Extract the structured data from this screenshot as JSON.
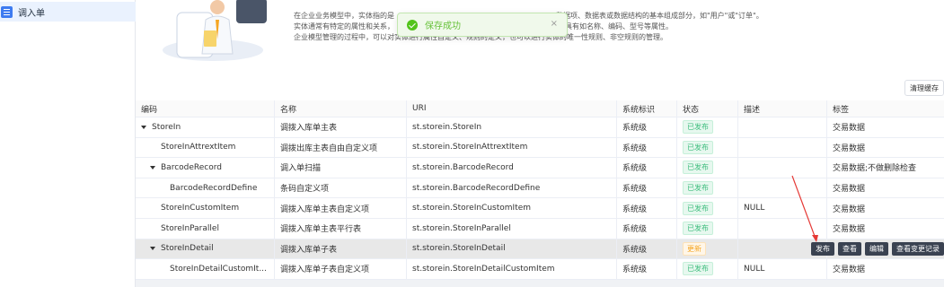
{
  "sidebar": {
    "item_label": "调入单"
  },
  "banner": {
    "line1_left": "在企业业务模型中，实体指的是",
    "line1_right": "数据项、数据表或数据结构的基本组成部分，如\"用户\"或\"订单\"。",
    "line2_left": "实体通常有特定的属性和关系，",
    "line2_right": "一个实体，具有如名称、编码、型号等属性。",
    "line3": "企业模型管理的过程中，可以对实体进行属性自定义、规则的定义，也可以进行实体的唯一性规则、非空规则的管理。"
  },
  "toast": {
    "message": "保存成功",
    "close": "×"
  },
  "toolbar": {
    "clear_cache": "清理缓存"
  },
  "table": {
    "headers": [
      "编码",
      "名称",
      "URI",
      "系统标识",
      "状态",
      "描述",
      "标签"
    ],
    "rows": [
      {
        "code": "StoreIn",
        "name": "调拨入库单主表",
        "uri": "st.storein.StoreIn",
        "sys": "系统级",
        "status": "已发布",
        "desc": "",
        "tag": "交易数据"
      },
      {
        "code": "StoreInAttrextItem",
        "name": "调拨出库主表自由自定义项",
        "uri": "st.storein.StoreInAttrextItem",
        "sys": "系统级",
        "status": "已发布",
        "desc": "",
        "tag": "交易数据"
      },
      {
        "code": "BarcodeRecord",
        "name": "调入单扫描",
        "uri": "st.storein.BarcodeRecord",
        "sys": "系统级",
        "status": "已发布",
        "desc": "",
        "tag": "交易数据;不做删除检查"
      },
      {
        "code": "BarcodeRecordDefine",
        "name": "条码自定义项",
        "uri": "st.storein.BarcodeRecordDefine",
        "sys": "系统级",
        "status": "已发布",
        "desc": "",
        "tag": "交易数据"
      },
      {
        "code": "StoreInCustomItem",
        "name": "调拨入库单主表自定义项",
        "uri": "st.storein.StoreInCustomItem",
        "sys": "系统级",
        "status": "已发布",
        "desc": "NULL",
        "tag": "交易数据"
      },
      {
        "code": "StoreInParallel",
        "name": "调拨入库单主表平行表",
        "uri": "st.storein.StoreInParallel",
        "sys": "系统级",
        "status": "已发布",
        "desc": "",
        "tag": "交易数据"
      },
      {
        "code": "StoreInDetail",
        "name": "调拨入库单子表",
        "uri": "st.storein.StoreInDetail",
        "sys": "系统级",
        "status": "更新",
        "desc": "",
        "tag": ""
      },
      {
        "code": "StoreInDetailCustomIt...",
        "name": "调拨入库单子表自定义项",
        "uri": "st.storein.StoreInDetailCustomItem",
        "sys": "系统级",
        "status": "已发布",
        "desc": "NULL",
        "tag": "交易数据"
      }
    ],
    "actions": [
      "发布",
      "查看",
      "编辑",
      "查看变更记录"
    ]
  },
  "colors": {
    "published": "#3dbd7d",
    "updated": "#f5a623",
    "accent": "#3e7bf0",
    "arrow": "#e53935"
  }
}
